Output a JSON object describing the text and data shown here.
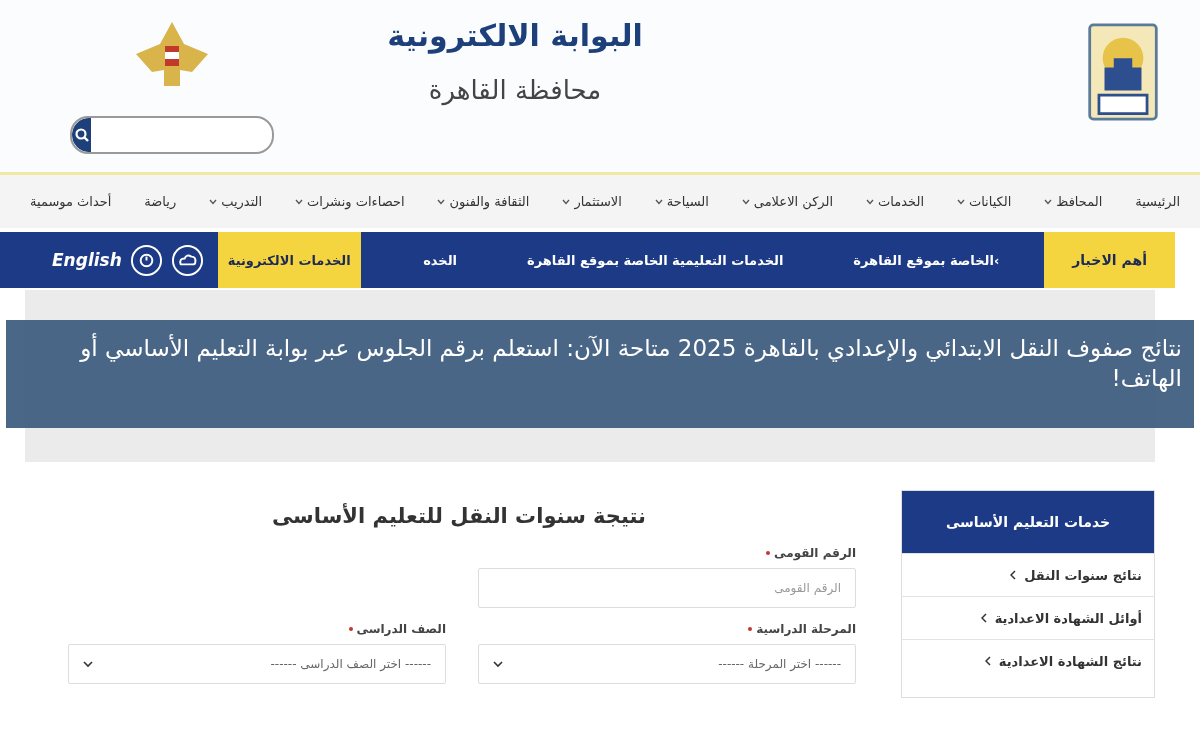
{
  "header": {
    "portal_title": "البوابة الالكترونية",
    "governorate": "محافظة القاهرة"
  },
  "nav": [
    {
      "label": "الرئيسية",
      "has_menu": false
    },
    {
      "label": "المحافظ",
      "has_menu": true
    },
    {
      "label": "الكيانات",
      "has_menu": true
    },
    {
      "label": "الخدمات",
      "has_menu": true
    },
    {
      "label": "الركن الاعلامى",
      "has_menu": true
    },
    {
      "label": "السياحة",
      "has_menu": true
    },
    {
      "label": "الاستثمار",
      "has_menu": true
    },
    {
      "label": "الثقافة والفنون",
      "has_menu": true
    },
    {
      "label": "احصاءات ونشرات",
      "has_menu": true
    },
    {
      "label": "التدريب",
      "has_menu": true
    },
    {
      "label": "رياضة",
      "has_menu": false
    },
    {
      "label": "أحداث موسمية",
      "has_menu": false
    }
  ],
  "news_bar": {
    "label": "أهم الاخبار",
    "ticker": [
      "›الخاصة بموقع القاهرة",
      "الخدمات التعليمية الخاصة بموقع القاهرة",
      "الخده"
    ],
    "eservices": "الخدمات الالكترونية",
    "language": "English"
  },
  "headline": "نتائج صفوف النقل الابتدائي والإعدادي بالقاهرة 2025 متاحة الآن: استعلم برقم الجلوس عبر بوابة التعليم الأساسي أو الهاتف!",
  "sidebar": {
    "title": "خدمات التعليم الأساسى",
    "items": [
      {
        "label": "نتائج سنوات النقل"
      },
      {
        "label": "أوائل الشهادة الاعدادية"
      },
      {
        "label": "نتائج الشهادة الاعدادية"
      }
    ]
  },
  "form": {
    "title": "نتيجة سنوات النقل للتعليم الأساسى",
    "national_id": {
      "label": "الرقم القومى",
      "placeholder": "الرقم القومى",
      "required": true
    },
    "stage": {
      "label": "المرحلة الدراسية",
      "value": "------ اختر المرحلة ------",
      "required": true
    },
    "grade": {
      "label": "الصف الدراسى",
      "value": "------ اختر الصف الدراسى ------",
      "required": true
    }
  }
}
